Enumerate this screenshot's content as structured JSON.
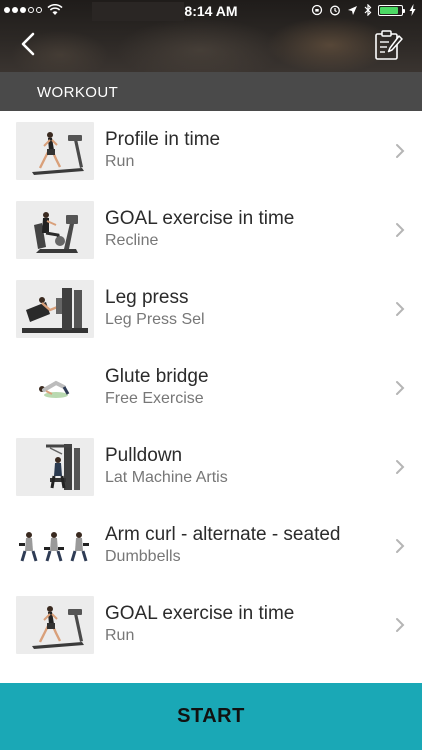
{
  "status": {
    "time": "8:14 AM",
    "battery_level": 0.85,
    "battery_color": "#4cd964"
  },
  "header": {
    "back_icon": "chevron-left-icon",
    "action_icon": "clipboard-edit-icon"
  },
  "section": {
    "title": "WORKOUT"
  },
  "exercises": [
    {
      "title": "Profile in time",
      "subtitle": "Run",
      "thumb": "treadmill-runner"
    },
    {
      "title": "GOAL exercise in time",
      "subtitle": "Recline",
      "thumb": "recumbent-bike"
    },
    {
      "title": "Leg press",
      "subtitle": "Leg Press Sel",
      "thumb": "leg-press-machine"
    },
    {
      "title": "Glute bridge",
      "subtitle": "Free Exercise",
      "thumb": "glute-bridge-pose"
    },
    {
      "title": "Pulldown",
      "subtitle": "Lat Machine Artis",
      "thumb": "lat-pulldown-machine"
    },
    {
      "title": "Arm curl - alternate - seated",
      "subtitle": "Dumbbells",
      "thumb": "seated-dumbbell-curl"
    },
    {
      "title": "GOAL exercise in time",
      "subtitle": "Run",
      "thumb": "treadmill-runner"
    }
  ],
  "start": {
    "label": "START",
    "color": "#1aa8b6"
  },
  "colors": {
    "section_bar": "#4a4a4a",
    "chevron": "#b5b5b5"
  }
}
